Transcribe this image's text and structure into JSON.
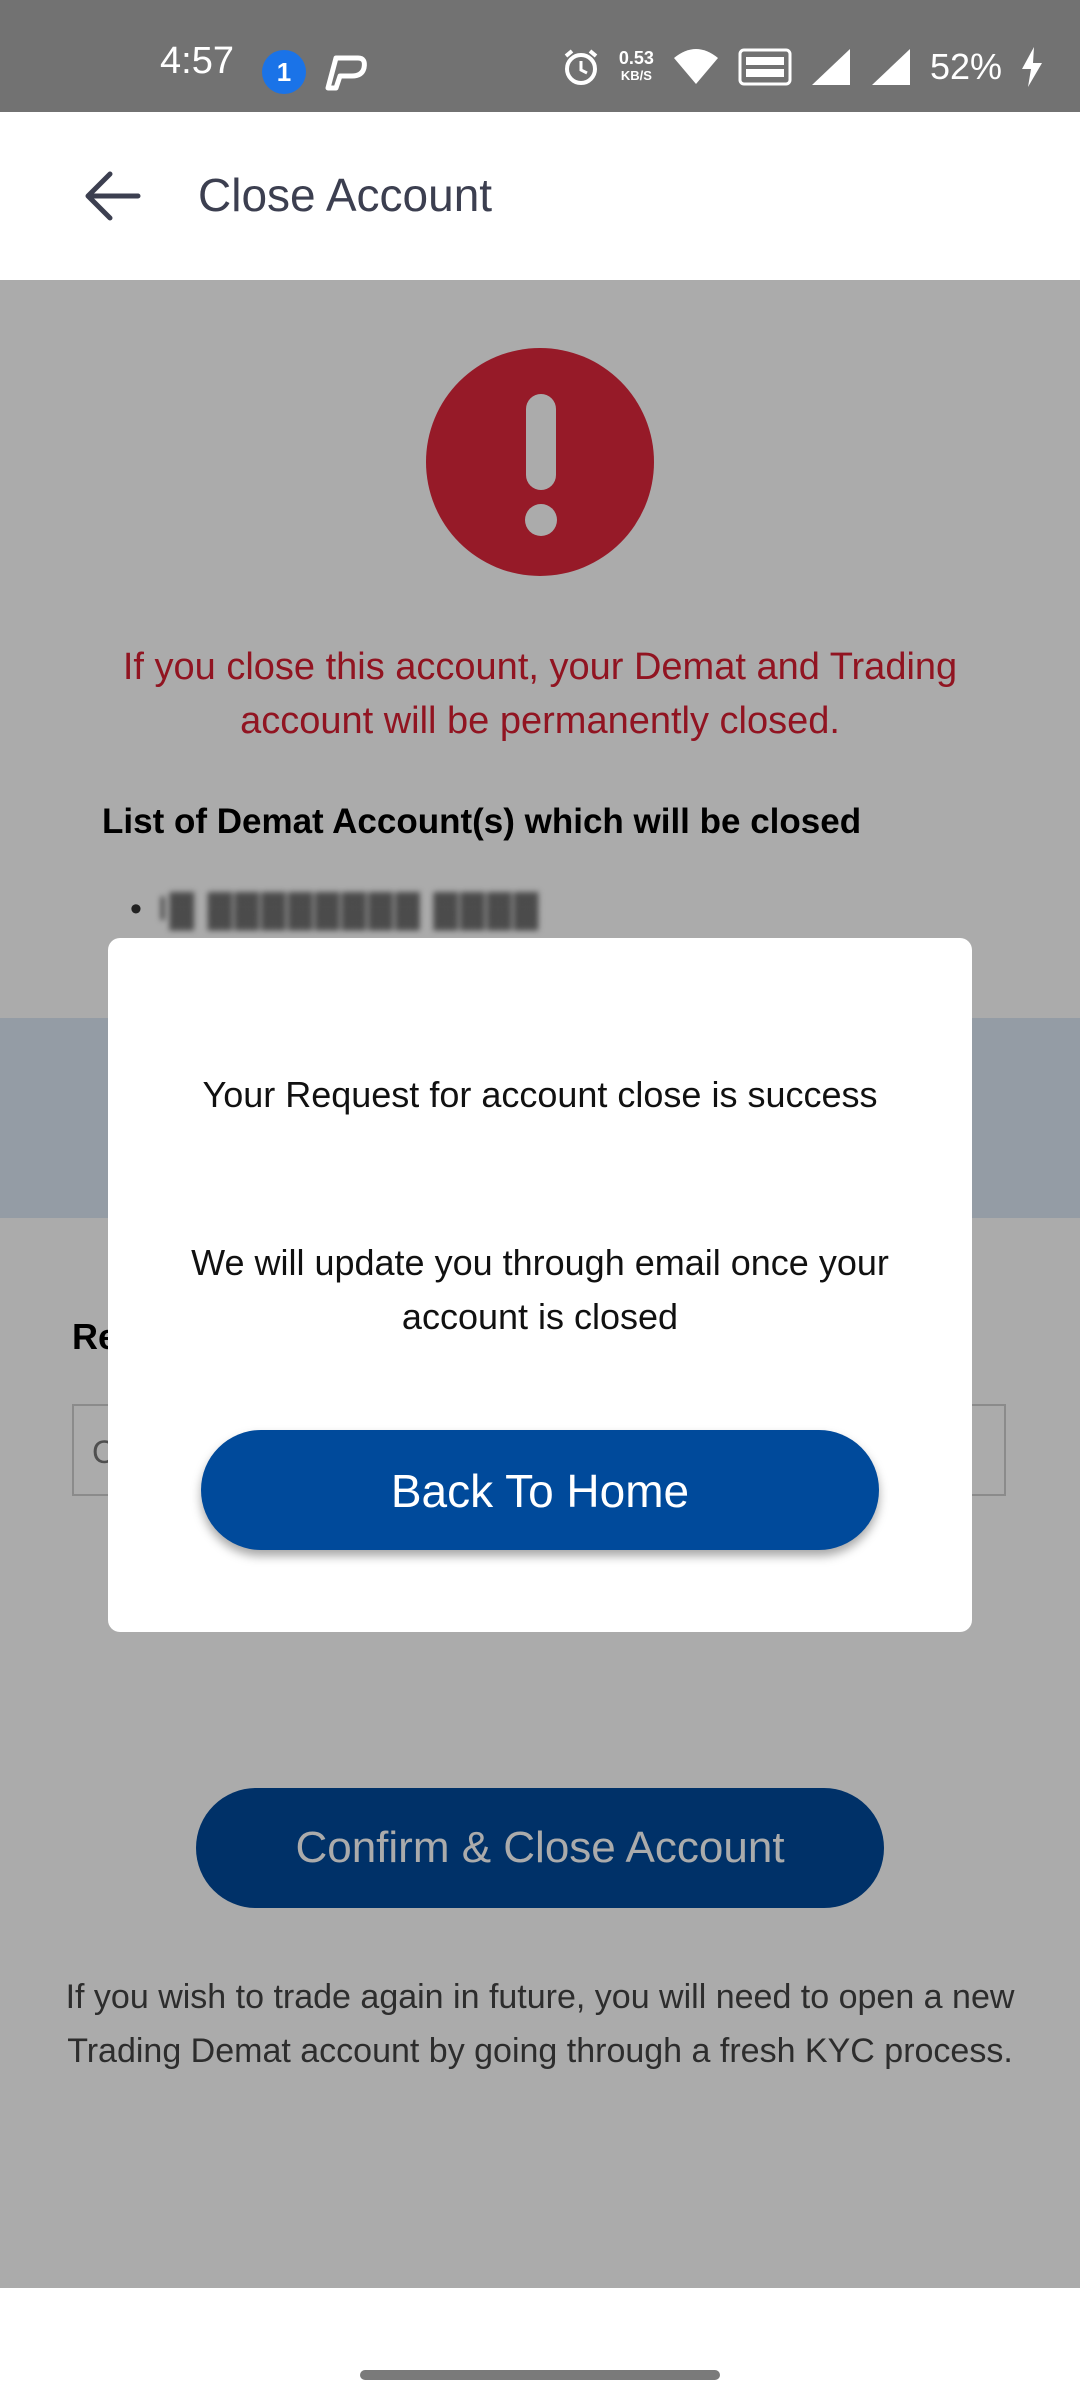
{
  "status_bar": {
    "time": "4:57",
    "notification_count": "1",
    "net_speed_value": "0.53",
    "net_speed_unit": "KB/S",
    "battery": "52%"
  },
  "header": {
    "title": "Close Account"
  },
  "content": {
    "warning": "If you close this account, your Demat and Trading account will be permanently closed.",
    "list_heading": "List of Demat Account(s) which will be closed",
    "account_masked": "I▓ ▓▓▓▓▓▓▓▓ ▓▓▓▓",
    "reason_label": "Re",
    "reason_placeholder": "C",
    "confirm_button": "Confirm & Close Account",
    "footer_note": "If you wish to trade again in future, you will need to open a new Trading Demat account by going through a fresh KYC process."
  },
  "dialog": {
    "message_1": "Your Request for account close is success",
    "message_2": "We will update you through email once your account is closed",
    "button_label": "Back To Home"
  },
  "colors": {
    "brand_blue": "#004a9b",
    "alert_red": "#e0273d",
    "warning_text": "#d81f32"
  }
}
